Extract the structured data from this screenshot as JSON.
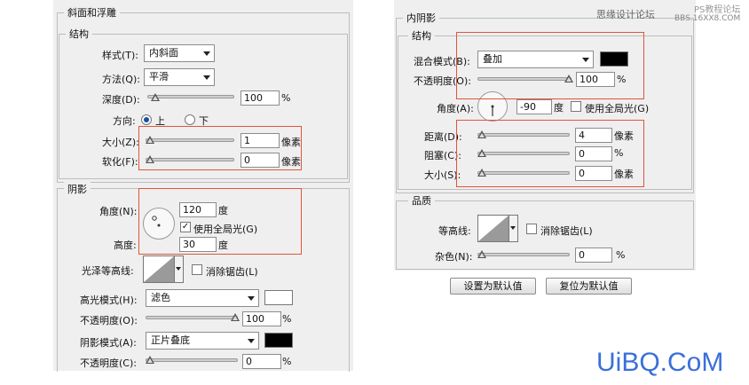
{
  "left_panel": {
    "bevel_title": "斜面和浮雕",
    "structure_title": "结构",
    "style_label": "样式(T):",
    "style_value": "内斜面",
    "technique_label": "方法(Q):",
    "technique_value": "平滑",
    "depth_label": "深度(D):",
    "depth_value": "100",
    "depth_unit": "%",
    "direction_label": "方向:",
    "direction_up": "上",
    "direction_down": "下",
    "size_label": "大小(Z):",
    "size_value": "1",
    "size_unit": "像素",
    "soften_label": "软化(F):",
    "soften_value": "0",
    "soften_unit": "像素",
    "shading_title": "阴影",
    "angle_label": "角度(N):",
    "angle_value": "120",
    "angle_unit": "度",
    "global_light_label": "使用全局光(G)",
    "global_light_checked": true,
    "altitude_label": "高度:",
    "altitude_value": "30",
    "altitude_unit": "度",
    "gloss_contour_label": "光泽等高线:",
    "antialias_label": "消除锯齿(L)",
    "highlight_mode_label": "高光模式(H):",
    "highlight_mode_value": "滤色",
    "highlight_color": "#ffffff",
    "highlight_opacity_label": "不透明度(O):",
    "highlight_opacity_value": "100",
    "highlight_opacity_unit": "%",
    "shadow_mode_label": "阴影模式(A):",
    "shadow_mode_value": "正片叠底",
    "shadow_color": "#000000",
    "shadow_opacity_label": "不透明度(C):",
    "shadow_opacity_value": "0",
    "shadow_opacity_unit": "%"
  },
  "right_panel": {
    "inner_shadow_title": "内阴影",
    "structure_title": "结构",
    "blend_mode_label": "混合模式(B):",
    "blend_mode_value": "叠加",
    "blend_color": "#000000",
    "opacity_label": "不透明度(O):",
    "opacity_value": "100",
    "opacity_unit": "%",
    "angle_label": "角度(A):",
    "angle_value": "-90",
    "angle_unit": "度",
    "global_light_label": "使用全局光(G)",
    "global_light_checked": false,
    "distance_label": "距离(D):",
    "distance_value": "4",
    "distance_unit": "像素",
    "choke_label": "阻塞(C):",
    "choke_value": "0",
    "choke_unit": "%",
    "size_label": "大小(S):",
    "size_value": "0",
    "size_unit": "像素",
    "quality_title": "品质",
    "contour_label": "等高线:",
    "antialias_label": "消除锯齿(L)",
    "noise_label": "杂色(N):",
    "noise_value": "0",
    "noise_unit": "%",
    "make_default_label": "设置为默认值",
    "reset_default_label": "复位为默认值"
  },
  "watermarks": {
    "top_right_line1": "思缘设计论坛",
    "top_right_line2": "PS教程论坛",
    "top_right_line3": "BBS.16XX8.COM",
    "bottom_right": "UiBQ.CoM"
  },
  "colors": {
    "panel_bg": "#efefef",
    "highlight_box": "#e0553a",
    "watermark_blue": "#3a6fd8"
  }
}
